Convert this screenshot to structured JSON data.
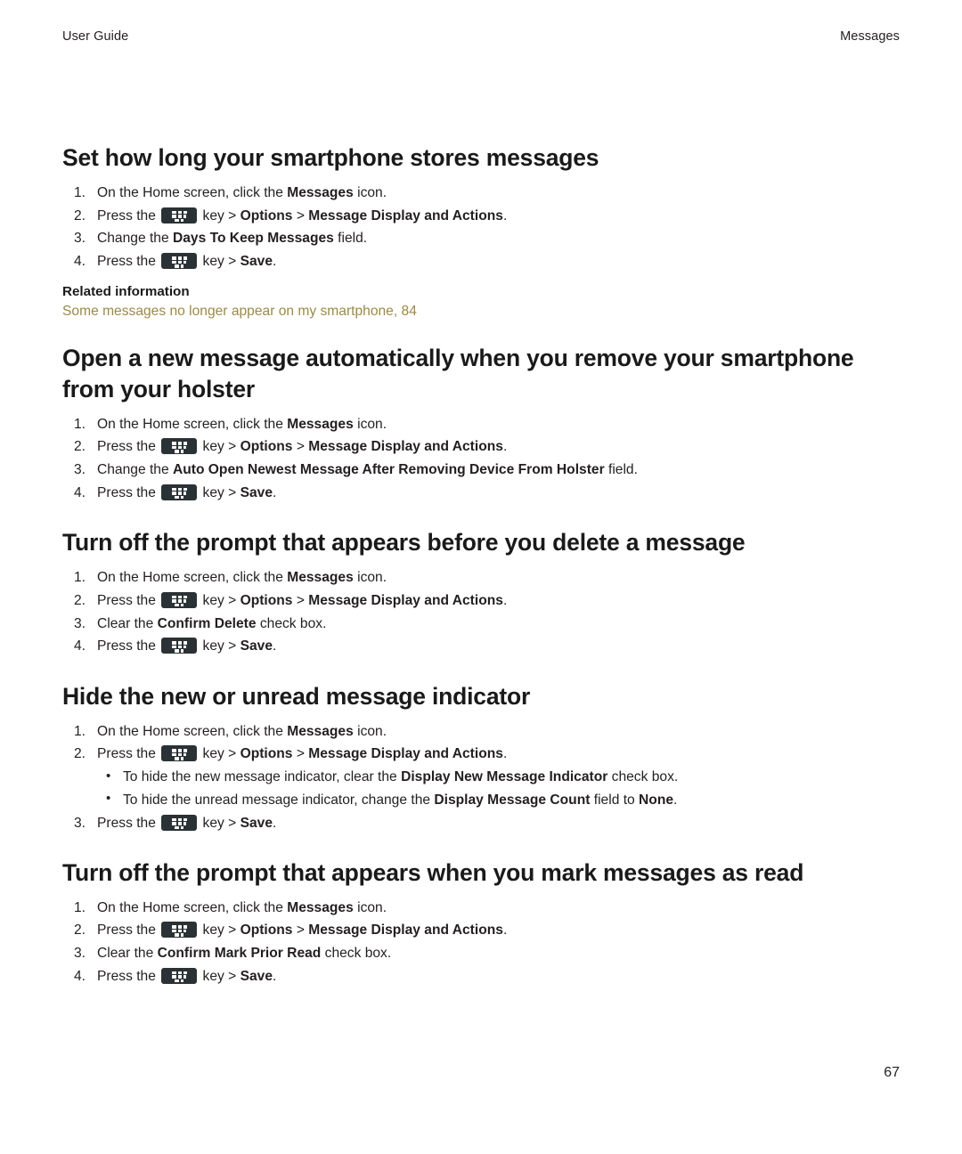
{
  "header": {
    "left": "User Guide",
    "right": "Messages"
  },
  "footer": {
    "page_number": "67"
  },
  "related": {
    "title": "Related information",
    "link": "Some messages no longer appear on my smartphone, 84",
    "link_color": "#9c8a42"
  },
  "icons": {
    "menu_key": "blackberry-menu-key-icon"
  },
  "sections": [
    {
      "title": "Set how long your smartphone stores messages",
      "steps": [
        {
          "num": "1.",
          "parts": [
            {
              "t": "On the Home screen, click the "
            },
            {
              "t": "Messages",
              "b": true
            },
            {
              "t": " icon."
            }
          ]
        },
        {
          "num": "2.",
          "parts": [
            {
              "t": "Press the "
            },
            {
              "icon": "menu-key"
            },
            {
              "t": " key > "
            },
            {
              "t": "Options",
              "b": true
            },
            {
              "t": " > "
            },
            {
              "t": "Message Display and Actions",
              "b": true
            },
            {
              "t": "."
            }
          ]
        },
        {
          "num": "3.",
          "parts": [
            {
              "t": "Change the "
            },
            {
              "t": "Days To Keep Messages",
              "b": true
            },
            {
              "t": " field."
            }
          ]
        },
        {
          "num": "4.",
          "parts": [
            {
              "t": "Press the "
            },
            {
              "icon": "menu-key"
            },
            {
              "t": " key > "
            },
            {
              "t": "Save",
              "b": true
            },
            {
              "t": "."
            }
          ]
        }
      ]
    },
    {
      "title": "Open a new message automatically when you remove your smartphone from your holster",
      "steps": [
        {
          "num": "1.",
          "parts": [
            {
              "t": "On the Home screen, click the "
            },
            {
              "t": "Messages",
              "b": true
            },
            {
              "t": " icon."
            }
          ]
        },
        {
          "num": "2.",
          "parts": [
            {
              "t": "Press the "
            },
            {
              "icon": "menu-key"
            },
            {
              "t": " key > "
            },
            {
              "t": "Options",
              "b": true
            },
            {
              "t": " > "
            },
            {
              "t": "Message Display and Actions",
              "b": true
            },
            {
              "t": "."
            }
          ]
        },
        {
          "num": "3.",
          "parts": [
            {
              "t": "Change the "
            },
            {
              "t": "Auto Open Newest Message After Removing Device From Holster",
              "b": true
            },
            {
              "t": " field."
            }
          ]
        },
        {
          "num": "4.",
          "parts": [
            {
              "t": "Press the "
            },
            {
              "icon": "menu-key"
            },
            {
              "t": " key > "
            },
            {
              "t": "Save",
              "b": true
            },
            {
              "t": "."
            }
          ]
        }
      ]
    },
    {
      "title": "Turn off the prompt that appears before you delete a message",
      "steps": [
        {
          "num": "1.",
          "parts": [
            {
              "t": "On the Home screen, click the "
            },
            {
              "t": "Messages",
              "b": true
            },
            {
              "t": " icon."
            }
          ]
        },
        {
          "num": "2.",
          "parts": [
            {
              "t": "Press the "
            },
            {
              "icon": "menu-key"
            },
            {
              "t": " key > "
            },
            {
              "t": "Options",
              "b": true
            },
            {
              "t": " > "
            },
            {
              "t": "Message Display and Actions",
              "b": true
            },
            {
              "t": "."
            }
          ]
        },
        {
          "num": "3.",
          "parts": [
            {
              "t": "Clear the "
            },
            {
              "t": "Confirm Delete",
              "b": true
            },
            {
              "t": " check box."
            }
          ]
        },
        {
          "num": "4.",
          "parts": [
            {
              "t": "Press the "
            },
            {
              "icon": "menu-key"
            },
            {
              "t": " key > "
            },
            {
              "t": "Save",
              "b": true
            },
            {
              "t": "."
            }
          ]
        }
      ]
    },
    {
      "title": "Hide the new or unread message indicator",
      "steps": [
        {
          "num": "1.",
          "parts": [
            {
              "t": "On the Home screen, click the "
            },
            {
              "t": "Messages",
              "b": true
            },
            {
              "t": " icon."
            }
          ]
        },
        {
          "num": "2.",
          "parts": [
            {
              "t": "Press the "
            },
            {
              "icon": "menu-key"
            },
            {
              "t": " key > "
            },
            {
              "t": "Options",
              "b": true
            },
            {
              "t": " > "
            },
            {
              "t": "Message Display and Actions",
              "b": true
            },
            {
              "t": "."
            }
          ],
          "bullets": [
            {
              "bullet": "•",
              "parts": [
                {
                  "t": "To hide the new message indicator, clear the "
                },
                {
                  "t": "Display New Message Indicator",
                  "b": true
                },
                {
                  "t": " check box."
                }
              ]
            },
            {
              "bullet": "•",
              "parts": [
                {
                  "t": "To hide the unread message indicator, change the "
                },
                {
                  "t": "Display Message Count",
                  "b": true
                },
                {
                  "t": " field to "
                },
                {
                  "t": "None",
                  "b": true
                },
                {
                  "t": "."
                }
              ]
            }
          ]
        },
        {
          "num": "3.",
          "parts": [
            {
              "t": "Press the "
            },
            {
              "icon": "menu-key"
            },
            {
              "t": " key > "
            },
            {
              "t": "Save",
              "b": true
            },
            {
              "t": "."
            }
          ]
        }
      ]
    },
    {
      "title": "Turn off the prompt that appears when you mark messages as read",
      "steps": [
        {
          "num": "1.",
          "parts": [
            {
              "t": "On the Home screen, click the "
            },
            {
              "t": "Messages",
              "b": true
            },
            {
              "t": " icon."
            }
          ]
        },
        {
          "num": "2.",
          "parts": [
            {
              "t": "Press the "
            },
            {
              "icon": "menu-key"
            },
            {
              "t": " key > "
            },
            {
              "t": "Options",
              "b": true
            },
            {
              "t": " > "
            },
            {
              "t": "Message Display and Actions",
              "b": true
            },
            {
              "t": "."
            }
          ]
        },
        {
          "num": "3.",
          "parts": [
            {
              "t": "Clear the "
            },
            {
              "t": "Confirm Mark Prior Read",
              "b": true
            },
            {
              "t": " check box."
            }
          ]
        },
        {
          "num": "4.",
          "parts": [
            {
              "t": "Press the "
            },
            {
              "icon": "menu-key"
            },
            {
              "t": " key > "
            },
            {
              "t": "Save",
              "b": true
            },
            {
              "t": "."
            }
          ]
        }
      ]
    }
  ],
  "related_after_section_index": 0
}
